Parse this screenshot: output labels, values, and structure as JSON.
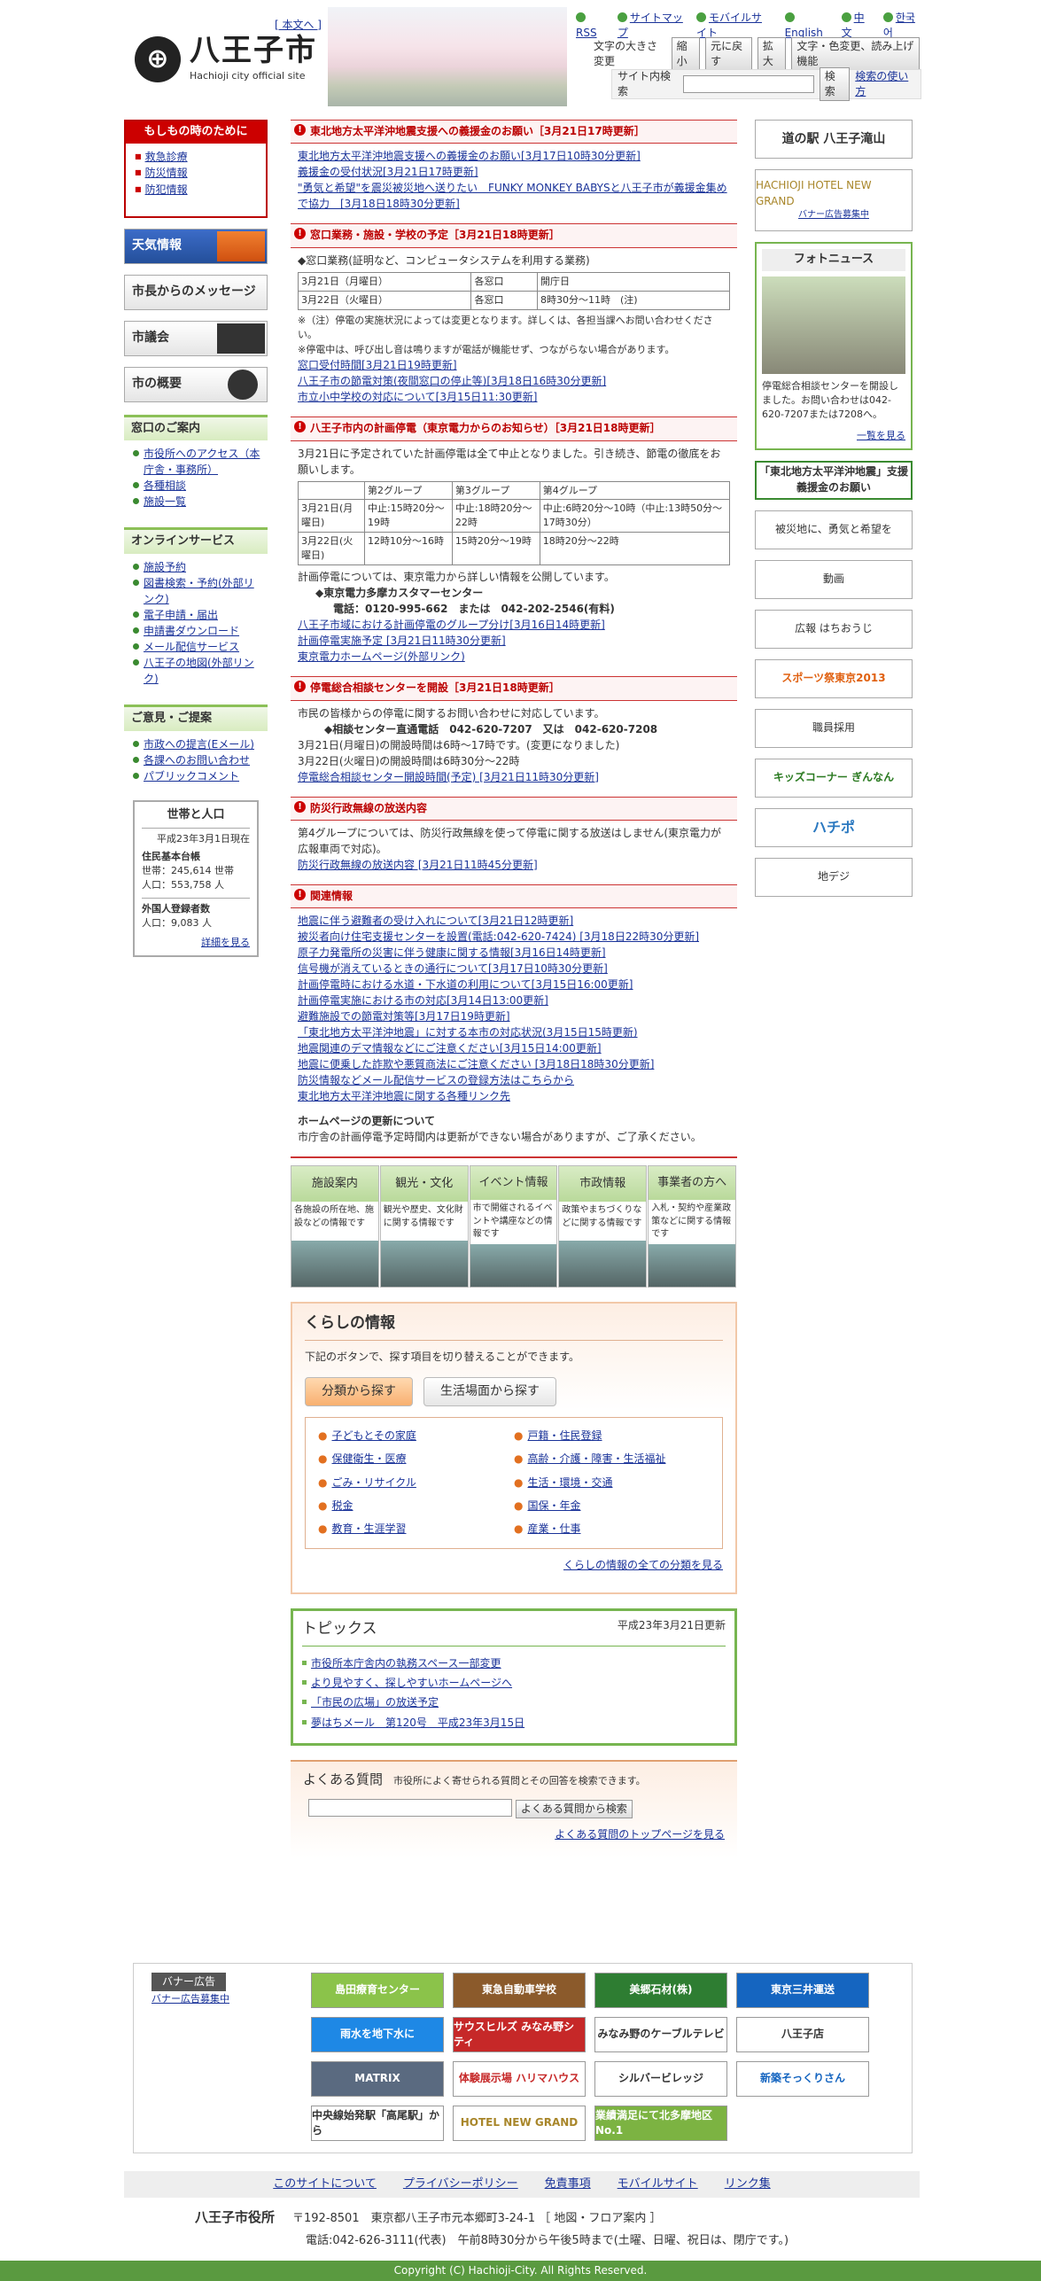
{
  "header": {
    "skip": "[ 本文へ ]",
    "city": "八王子市",
    "sub": "Hachioji city official site",
    "toplinks": [
      "RSS",
      "サイトマップ",
      "モバイルサイト",
      "English",
      "中文",
      "한국어"
    ],
    "size_label": "文字の大きさ変更",
    "size_btns": [
      "縮小",
      "元に戻す",
      "拡大"
    ],
    "color_btn": "文字・色変更、読み上げ機能",
    "search_label": "サイト内検索",
    "search_btn": "検索",
    "search_help": "検索の使い方"
  },
  "left": {
    "emerg_title": "もしもの時のために",
    "emerg_items": [
      "救急診療",
      "防災情報",
      "防犯情報"
    ],
    "tenki": "天気情報",
    "msg": "市長からのメッセージ",
    "gikai": "市議会",
    "gaiyo": "市の概要",
    "sec1": {
      "title": "窓口のご案内",
      "items": [
        "市役所へのアクセス（本庁舎・事務所）",
        "各種相談",
        "施設一覧"
      ]
    },
    "sec2": {
      "title": "オンラインサービス",
      "items": [
        "施設予約",
        "図書検索・予約(外部リンク)",
        "電子申請・届出",
        "申請書ダウンロード",
        "メール配信サービス",
        "八王子の地図(外部リンク)"
      ]
    },
    "sec3": {
      "title": "ご意見・ご提案",
      "items": [
        "市政への提言(Eメール)",
        "各課へのお問い合わせ",
        "パブリックコメント"
      ]
    },
    "pop": {
      "title": "世帯と人口",
      "date": "平成23年3月1日現在",
      "h1": "住民基本台帳",
      "l1": "世帯：245,614 世帯",
      "l2": "人口：553,758 人",
      "h2": "外国人登録者数",
      "l3": "人口：9,083 人",
      "more": "詳細を見る"
    }
  },
  "main": {
    "n1": {
      "title": "東北地方太平洋沖地震支援への義援金のお願い［3月21日17時更新］",
      "links": [
        "東北地方太平洋沖地震支援への義援金のお願い[3月17日10時30分更新]",
        "義援金の受付状況[3月21日17時更新]",
        "\"勇気と希望\"を震災被災地へ送りたい　FUNKY MONKEY BABYSと八王子市が義援金集めで協力　[3月18日18時30分更新]"
      ]
    },
    "n2": {
      "title": "窓口業務・施設・学校の予定［3月21日18時更新］",
      "intro": "◆窓口業務(証明など、コンピュータシステムを利用する業務)",
      "rows": [
        [
          "3月21日（月曜日）",
          "各窓口",
          "開庁日"
        ],
        [
          "3月22日（火曜日）",
          "各窓口",
          "8時30分～11時　(注)"
        ]
      ],
      "note1": "※（注）停電の実施状況によっては変更となります。詳しくは、各担当課へお問い合わせください。",
      "note2": "※停電中は、呼び出し音は鳴りますが電話が機能せず、つながらない場合があります。",
      "links": [
        "窓口受付時間[3月21日19時更新]",
        "八王子市の節電対策(夜間窓口の停止等)[3月18日16時30分更新]",
        "市立小中学校の対応について[3月15日11:30更新]"
      ]
    },
    "n3": {
      "title": "八王子市内の計画停電（東京電力からのお知らせ）［3月21日18時更新］",
      "intro": "3月21日に予定されていた計画停電は全て中止となりました。引き続き、節電の徹底をお願いします。",
      "head": [
        "",
        "第2グループ",
        "第3グループ",
        "第4グループ"
      ],
      "rows": [
        [
          "3月21日(月曜日)",
          "中止:15時20分～19時",
          "中止:18時20分～22時",
          "中止:6時20分～10時（中止:13時50分～17時30分）"
        ],
        [
          "3月22日(火曜日)",
          "12時10分～16時",
          "15時20分～19時",
          "18時20分～22時"
        ]
      ],
      "b1": "計画停電については、東京電力から詳しい情報を公開しています。",
      "b2": "◆東京電力多摩カスタマーセンター",
      "b3": "電話：0120-995-662　または　042-202-2546(有料)",
      "links": [
        "八王子市域における計画停電のグループ分け[3月16日14時更新]",
        "計画停電実施予定 [3月21日11時30分更新]",
        "東京電力ホームページ(外部リンク)"
      ]
    },
    "n4": {
      "title": "停電総合相談センターを開設［3月21日18時更新］",
      "intro": "市民の皆様からの停電に関するお問い合わせに対応しています。",
      "tel": "◆相談センター直通電話　042-620-7207　又は　042-620-7208",
      "b1": "3月21日(月曜日)の開設時間は6時～17時です。(変更になりました)",
      "b2": "3月22日(火曜日)の開設時間は6時30分～22時",
      "links": [
        "停電総合相談センター開設時間(予定) [3月21日11時30分更新]"
      ]
    },
    "n5": {
      "title": "防災行政無線の放送内容",
      "intro": "第4グループについては、防災行政無線を使って停電に関する放送はしません(東京電力が広報車両で対応)。",
      "links": [
        "防災行政無線の放送内容 [3月21日11時45分更新]"
      ]
    },
    "n6": {
      "title": "関連情報",
      "links": [
        "地震に伴う避難者の受け入れについて[3月21日12時更新]",
        "被災者向け住宅支援センターを設置(電話:042-620-7424) [3月18日22時30分更新]",
        "原子力発電所の災害に伴う健康に関する情報[3月16日14時更新]",
        "信号機が消えているときの通行について[3月17日10時30分更新]",
        "計画停電時における水道・下水道の利用について[3月15日16:00更新]",
        "計画停電実施における市の対応[3月14日13:00更新]",
        "避難施設での節電対策等[3月17日19時更新]",
        "「東北地方太平洋沖地震」に対する本市の対応状況(3月15日15時更新)",
        "地震関連のデマ情報などにご注意ください[3月15日14:00更新]",
        "地震に便乗した詐欺や悪質商法にご注意ください [3月18日18時30分更新]",
        "防災情報などメール配信サービスの登録方法はこちらから",
        "東北地方太平洋沖地震に関する各種リンク先"
      ]
    },
    "upd": {
      "title": "ホームページの更新について",
      "text": "市庁舎の計画停電予定時間内は更新ができない場合がありますが、ご了承ください。"
    },
    "tiles": [
      {
        "h": "施設案内",
        "d": "各施設の所在地、施設などの情報です"
      },
      {
        "h": "観光・文化",
        "d": "観光や歴史、文化財に関する情報です"
      },
      {
        "h": "イベント情報",
        "d": "市で開催されるイベントや講座などの情報です"
      },
      {
        "h": "市政情報",
        "d": "政策やまちづくりなどに関する情報です"
      },
      {
        "h": "事業者の方へ",
        "d": "入札・契約や産業政策などに関する情報です"
      }
    ],
    "kurashi": {
      "title": "くらしの情報",
      "intro": "下記のボタンで、探す項目を切り替えることができます。",
      "tab1": "分類から探す",
      "tab2": "生活場面から探す",
      "items": [
        "子どもとその家庭",
        "戸籍・住民登録",
        "保健衛生・医療",
        "高齢・介護・障害・生活福祉",
        "ごみ・リサイクル",
        "生活・環境・交通",
        "税金",
        "国保・年金",
        "教育・生涯学習",
        "産業・仕事"
      ],
      "all": "くらしの情報の全ての分類を見る"
    },
    "topics": {
      "title": "トピックス",
      "date": "平成23年3月21日更新",
      "items": [
        "市役所本庁舎内の執務スペース一部変更",
        "より見やすく、探しやすいホームページへ",
        "「市民の広場」の放送予定",
        "夢はちメール　第120号　平成23年3月15日"
      ]
    },
    "faq": {
      "title": "よくある質問",
      "desc": "市役所によく寄せられる質問とその回答を検索できます。",
      "btn": "よくある質問から検索",
      "top": "よくある質問のトップページを見る"
    }
  },
  "right": {
    "b1": "道の駅 八王子滝山",
    "b2": "HACHIOJI HOTEL NEW GRAND",
    "b2l": "バナー広告募集中",
    "photo_title": "フォトニュース",
    "photo_text": "停電総合相談センターを開設しました。お問い合わせは042-620-7207または7208へ。",
    "photo_more": "一覧を見る",
    "b3": "「東北地方太平洋沖地震」支援義援金のお願い",
    "b4": "被災地に、勇気と希望を",
    "b5": "動画",
    "b6": "広報 はちおうじ",
    "b7": "スポーツ祭東京2013",
    "b8": "職員採用",
    "b9": "キッズコーナー ぎんなん",
    "b10": "ハチポ",
    "b11": "地デジ"
  },
  "banners": {
    "label": "バナー広告",
    "link": "バナー広告募集中",
    "items": [
      "島田療育センター",
      "東急自動車学校",
      "美郷石材(株)",
      "東京三井運送",
      "雨水を地下水に",
      "サウスヒルズ みなみ野シティ",
      "みなみ野のケーブルテレビ",
      "八王子店",
      "MATRIX",
      "体験展示場 ハリマハウス",
      "シルバービレッジ",
      "新築そっくりさん",
      "中央線始発駅「高尾駅」から",
      "HOTEL NEW GRAND",
      "業績満足にて北多摩地区No.1"
    ]
  },
  "footer": {
    "nav": [
      "このサイトについて",
      "プライバシーポリシー",
      "免責事項",
      "モバイルサイト",
      "リンク集"
    ],
    "name": "八王子市役所",
    "addr": "〒192-8501　東京都八王子市元本郷町3-24-1 ［ 地図・フロア案内 ］",
    "tel": "電話:042-626-3111(代表)　午前8時30分から午後5時まで(土曜、日曜、祝日は、閉庁です。)",
    "copy": "Copyright (C) Hachioji-City. All Rights Reserved."
  }
}
